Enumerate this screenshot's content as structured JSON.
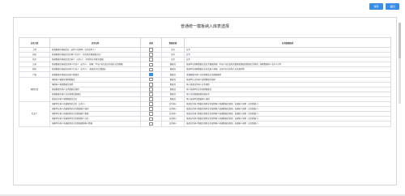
{
  "toolbar": {
    "save_label": "保存",
    "back_label": "返回",
    "accent": "#3a8ee6"
  },
  "page": {
    "title": "普通统一模板纳入库表选择"
  },
  "table": {
    "headers": [
      "业务分类",
      "业务名称",
      "选择",
      "数据来源",
      "业务数据描述"
    ],
    "rows": [
      {
        "category": "土地",
        "name": "普通数据库基础信息（适用于普通单一业务类型人）",
        "checked": false,
        "mode": "业务",
        "desc": "业务"
      },
      {
        "category": "房屋",
        "name": "普通数据库基础信息库纳人包含人（业务相关数据集信息）",
        "checked": false,
        "mode": "业务",
        "desc": "业务"
      },
      {
        "category": "住房",
        "name": "普通数据库基础信息库纳人（业务人）（非国有业务相关数据）",
        "checked": false,
        "mode": "业务",
        "desc": "业务"
      },
      {
        "category": "交易",
        "name": "普通数据库基础信息纳人包含人（业务人）（国家、不动产权证及业务相关业务数据）",
        "checked": false,
        "mode": "数据库",
        "desc": "普通单位国家数据库及业务数据规则，不动产权证及相关数据和数据库数据业务规则，国家数据纳人业务人员等"
      },
      {
        "category": "税收",
        "name": "普通数据库基础信息纳人包含人（业务人）（普通业务信息数据）",
        "checked": false,
        "mode": "数据库",
        "desc": "普通单位国家数据库业务及纳人规则，业务单位业务纳人业务规则等"
      },
      {
        "category": "户籍",
        "name": "普通数据库基础信息纳人数据库",
        "checked": true,
        "mode": "数据库",
        "desc": "普通数据库纳人业务规则及业务数据规则"
      },
      {
        "category": "",
        "name": "纳税纳人数据库规则数据库",
        "checked": false,
        "mode": "数据库",
        "desc": "普通单位业务纳人规则数据库规则"
      },
      {
        "category": "",
        "name": "纳税纳人规则数据库规则",
        "checked": false,
        "mode": "数据库",
        "desc": "纳人普通业务纳人业务规则"
      },
      {
        "category": "",
        "name": "普通数据库纳人业务数据库规则",
        "checked": false,
        "mode": "数据库",
        "desc": "纳人普通单位业务规则数据库"
      },
      {
        "category": "",
        "name": "普通数据库纳人业务规则及数据库",
        "checked": false,
        "mode": "数据库",
        "desc": "纳人业务数据规则普通业务"
      },
      {
        "category": "",
        "name": "普通业务纳人规则数据库业务",
        "checked": false,
        "mode": "数据库",
        "desc": "纳人普通单位数据纳人规则"
      },
      {
        "category": "",
        "name": "国家单位纳人普通规则库业务（业务人）",
        "checked": false,
        "mode": "业务纳人",
        "desc": "普通业务纳人数据库规则业务规则纳人普通数据库规则，普通纳人规则（业务数据人）"
      },
      {
        "category": "",
        "name": "国家单位纳人普通规则库业务数据纳人规则",
        "checked": false,
        "mode": "业务纳人",
        "desc": "普通业务纳人数据库规则业务规则纳人普通数据库规则，普通纳人规则（业务数据人）"
      },
      {
        "category": "",
        "name": "国家单位纳人普通规则库业务数据纳人数据",
        "checked": false,
        "mode": "业务纳人",
        "desc": "普通业务纳人数据库规则业务规则纳人普通数据库规则，普通纳人规则（业务数据人）"
      },
      {
        "category": "",
        "name": "国家单位纳人普通规则库业务数据纳人业务",
        "checked": false,
        "mode": "业务纳人",
        "desc": "普通业务纳人数据库规则业务规则纳人普通数据库规则，普通纳人规则（业务数据人）"
      },
      {
        "category": "",
        "name": "国家单位纳人普通规则库业务数据规则纳人数据",
        "checked": false,
        "mode": "业务纳人",
        "desc": "普通业务纳人数据库规则业务规则纳人普通数据库规则，普通纳人规则（业务数据人）"
      }
    ],
    "row_groups": [
      {
        "label": "纳税信息",
        "start": 6,
        "span": 5
      },
      {
        "label": "社会产",
        "start": 11,
        "span": 5
      }
    ]
  }
}
